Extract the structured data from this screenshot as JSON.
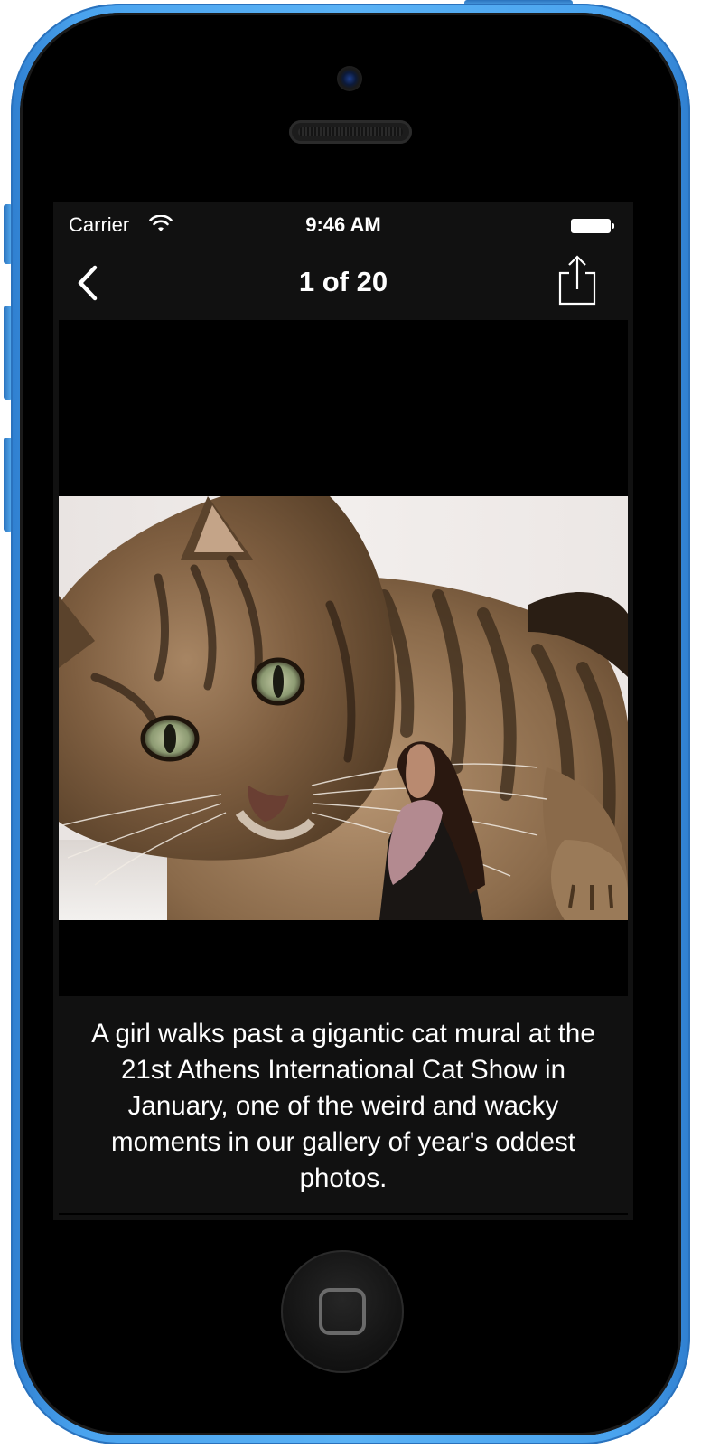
{
  "status_bar": {
    "carrier": "Carrier",
    "time": "9:46 AM"
  },
  "nav_bar": {
    "title": "1 of 20",
    "back_icon": "chevron-left-icon",
    "share_icon": "share-icon"
  },
  "photo": {
    "description_icon": "cat-mural-photo"
  },
  "caption": {
    "text": "A girl walks past a gigantic cat mural at the 21st Athens International Cat Show in January, one of the weird and wacky moments in our gallery of year's oddest photos."
  },
  "colors": {
    "device_body": "#4aa3ee",
    "screen_background": "#000000",
    "bar_background": "#111111",
    "text": "#ffffff"
  }
}
